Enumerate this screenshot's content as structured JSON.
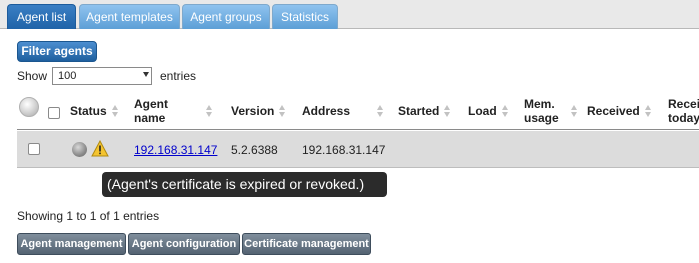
{
  "tabs": [
    {
      "label": "Agent list"
    },
    {
      "label": "Agent templates"
    },
    {
      "label": "Agent groups"
    },
    {
      "label": "Statistics"
    }
  ],
  "toolbar": {
    "filter_label": "Filter agents"
  },
  "length": {
    "show_label": "Show",
    "selected": "100",
    "entries_label": "entries"
  },
  "table": {
    "columns": {
      "status": "Status",
      "agent_name": "Agent name",
      "version": "Version",
      "address": "Address",
      "started": "Started",
      "load": "Load",
      "mem_usage": "Mem. usage",
      "received": "Received",
      "received_today": "Received today"
    },
    "rows": [
      {
        "agent_name": "192.168.31.147",
        "version": "5.2.6388",
        "address": "192.168.31.147",
        "started": "",
        "load": "",
        "mem_usage": "",
        "received": "",
        "received_today": ""
      }
    ]
  },
  "tooltip": {
    "text": "(Agent's certificate is expired or revoked.)"
  },
  "info": {
    "text": "Showing 1 to 1 of 1 entries"
  },
  "actions": {
    "agent_management": "Agent management",
    "agent_configuration": "Agent configuration",
    "certificate_management": "Certificate management"
  },
  "colors": {
    "accent": "#1f63a8",
    "tab_inactive": "#6aaae0",
    "row_bg": "#dcdcdc",
    "button_grey": "#5f6e7d",
    "tooltip_bg": "#2b2b2b"
  }
}
